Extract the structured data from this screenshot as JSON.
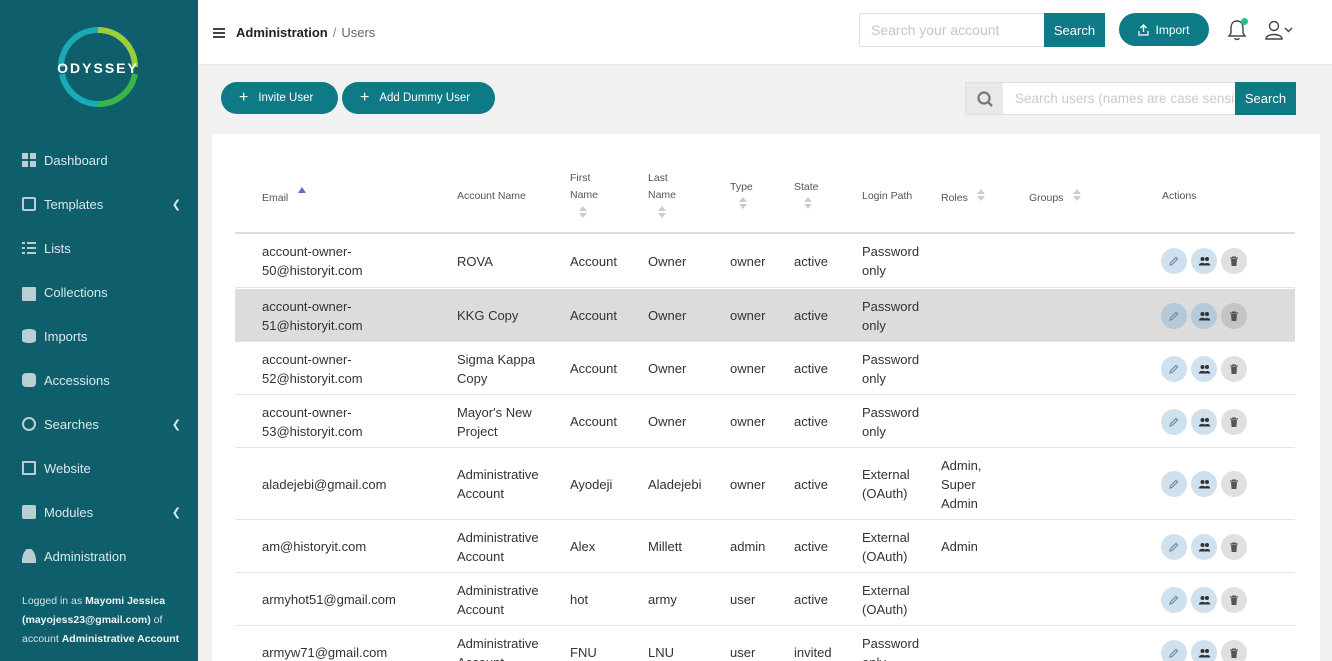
{
  "brand": {
    "name": "ODYSSEY"
  },
  "sidebar": {
    "items": [
      {
        "label": "Dashboard",
        "icon": "dashboard-icon",
        "submenu": false
      },
      {
        "label": "Templates",
        "icon": "file-icon",
        "submenu": true
      },
      {
        "label": "Lists",
        "icon": "list-icon",
        "submenu": false
      },
      {
        "label": "Collections",
        "icon": "archive-icon",
        "submenu": false
      },
      {
        "label": "Imports",
        "icon": "database-icon",
        "submenu": false
      },
      {
        "label": "Accessions",
        "icon": "handshake-icon",
        "submenu": false
      },
      {
        "label": "Searches",
        "icon": "search-icon",
        "submenu": true
      },
      {
        "label": "Website",
        "icon": "monitor-icon",
        "submenu": false
      },
      {
        "label": "Modules",
        "icon": "puzzle-icon",
        "submenu": true
      },
      {
        "label": "Administration",
        "icon": "user-icon",
        "submenu": false
      }
    ],
    "footer": {
      "prefix": "Logged in as",
      "user": "Mayomi Jessica (mayojess23@gmail.com)",
      "mid": "of account",
      "account": "Administrative Account"
    }
  },
  "topbar": {
    "breadcrumb": {
      "section": "Administration",
      "separator": "/",
      "page": "Users"
    },
    "search_placeholder": "Search your account",
    "search_label": "Search",
    "import_label": "Import"
  },
  "toolbar": {
    "invite_label": "Invite User",
    "dummy_label": "Add Dummy User",
    "search_placeholder": "Search users (names are case sensitive)",
    "search_label": "Search"
  },
  "table": {
    "headers": {
      "email": "Email",
      "account_name": "Account Name",
      "first_name_1": "First",
      "first_name_2": "Name",
      "last_name_1": "Last",
      "last_name_2": "Name",
      "type": "Type",
      "state": "State",
      "login_path": "Login Path",
      "roles": "Roles",
      "groups": "Groups",
      "actions": "Actions"
    },
    "sorted_column": "email",
    "sort_direction": "ascending",
    "rows": [
      {
        "email": [
          "account-owner-",
          "50@historyit.com"
        ],
        "account": [
          "ROVA"
        ],
        "first": "Account",
        "last": "Owner",
        "type": "owner",
        "state": "active",
        "login": [
          "Password",
          "only"
        ],
        "roles": []
      },
      {
        "email": [
          "account-owner-",
          "51@historyit.com"
        ],
        "account": [
          "KKG Copy"
        ],
        "first": "Account",
        "last": "Owner",
        "type": "owner",
        "state": "active",
        "login": [
          "Password",
          "only"
        ],
        "roles": [],
        "highlighted": true
      },
      {
        "email": [
          "account-owner-",
          "52@historyit.com"
        ],
        "account": [
          "Sigma Kappa",
          "Copy"
        ],
        "first": "Account",
        "last": "Owner",
        "type": "owner",
        "state": "active",
        "login": [
          "Password",
          "only"
        ],
        "roles": []
      },
      {
        "email": [
          "account-owner-",
          "53@historyit.com"
        ],
        "account": [
          "Mayor's New",
          "Project"
        ],
        "first": "Account",
        "last": "Owner",
        "type": "owner",
        "state": "active",
        "login": [
          "Password",
          "only"
        ],
        "roles": []
      },
      {
        "email": [
          "aladejebi@gmail.com"
        ],
        "account": [
          "Administrative",
          "Account"
        ],
        "first": "Ayodeji",
        "last": "Aladejebi",
        "type": "owner",
        "state": "active",
        "login": [
          "External",
          "(OAuth)"
        ],
        "roles": [
          "Admin,",
          "Super",
          "Admin"
        ]
      },
      {
        "email": [
          "am@historyit.com"
        ],
        "account": [
          "Administrative",
          "Account"
        ],
        "first": "Alex",
        "last": "Millett",
        "type": "admin",
        "state": "active",
        "login": [
          "External",
          "(OAuth)"
        ],
        "roles": [
          "Admin"
        ]
      },
      {
        "email": [
          "armyhot51@gmail.com"
        ],
        "account": [
          "Administrative",
          "Account"
        ],
        "first": "hot",
        "last": "army",
        "type": "user",
        "state": "active",
        "login": [
          "External",
          "(OAuth)"
        ],
        "roles": []
      },
      {
        "email": [
          "armyw71@gmail.com"
        ],
        "account": [
          "Administrative",
          "Account"
        ],
        "first": "FNU",
        "last": "LNU",
        "type": "user",
        "state": "invited",
        "login": [
          "Password",
          "only"
        ],
        "roles": []
      }
    ]
  },
  "colors": {
    "sidebar": "#0e5f6b",
    "accent": "#0e7a85",
    "notification_dot": "#27c28a",
    "sort_active": "#5b6fd6",
    "row_highlight": "#dcdcdc"
  }
}
